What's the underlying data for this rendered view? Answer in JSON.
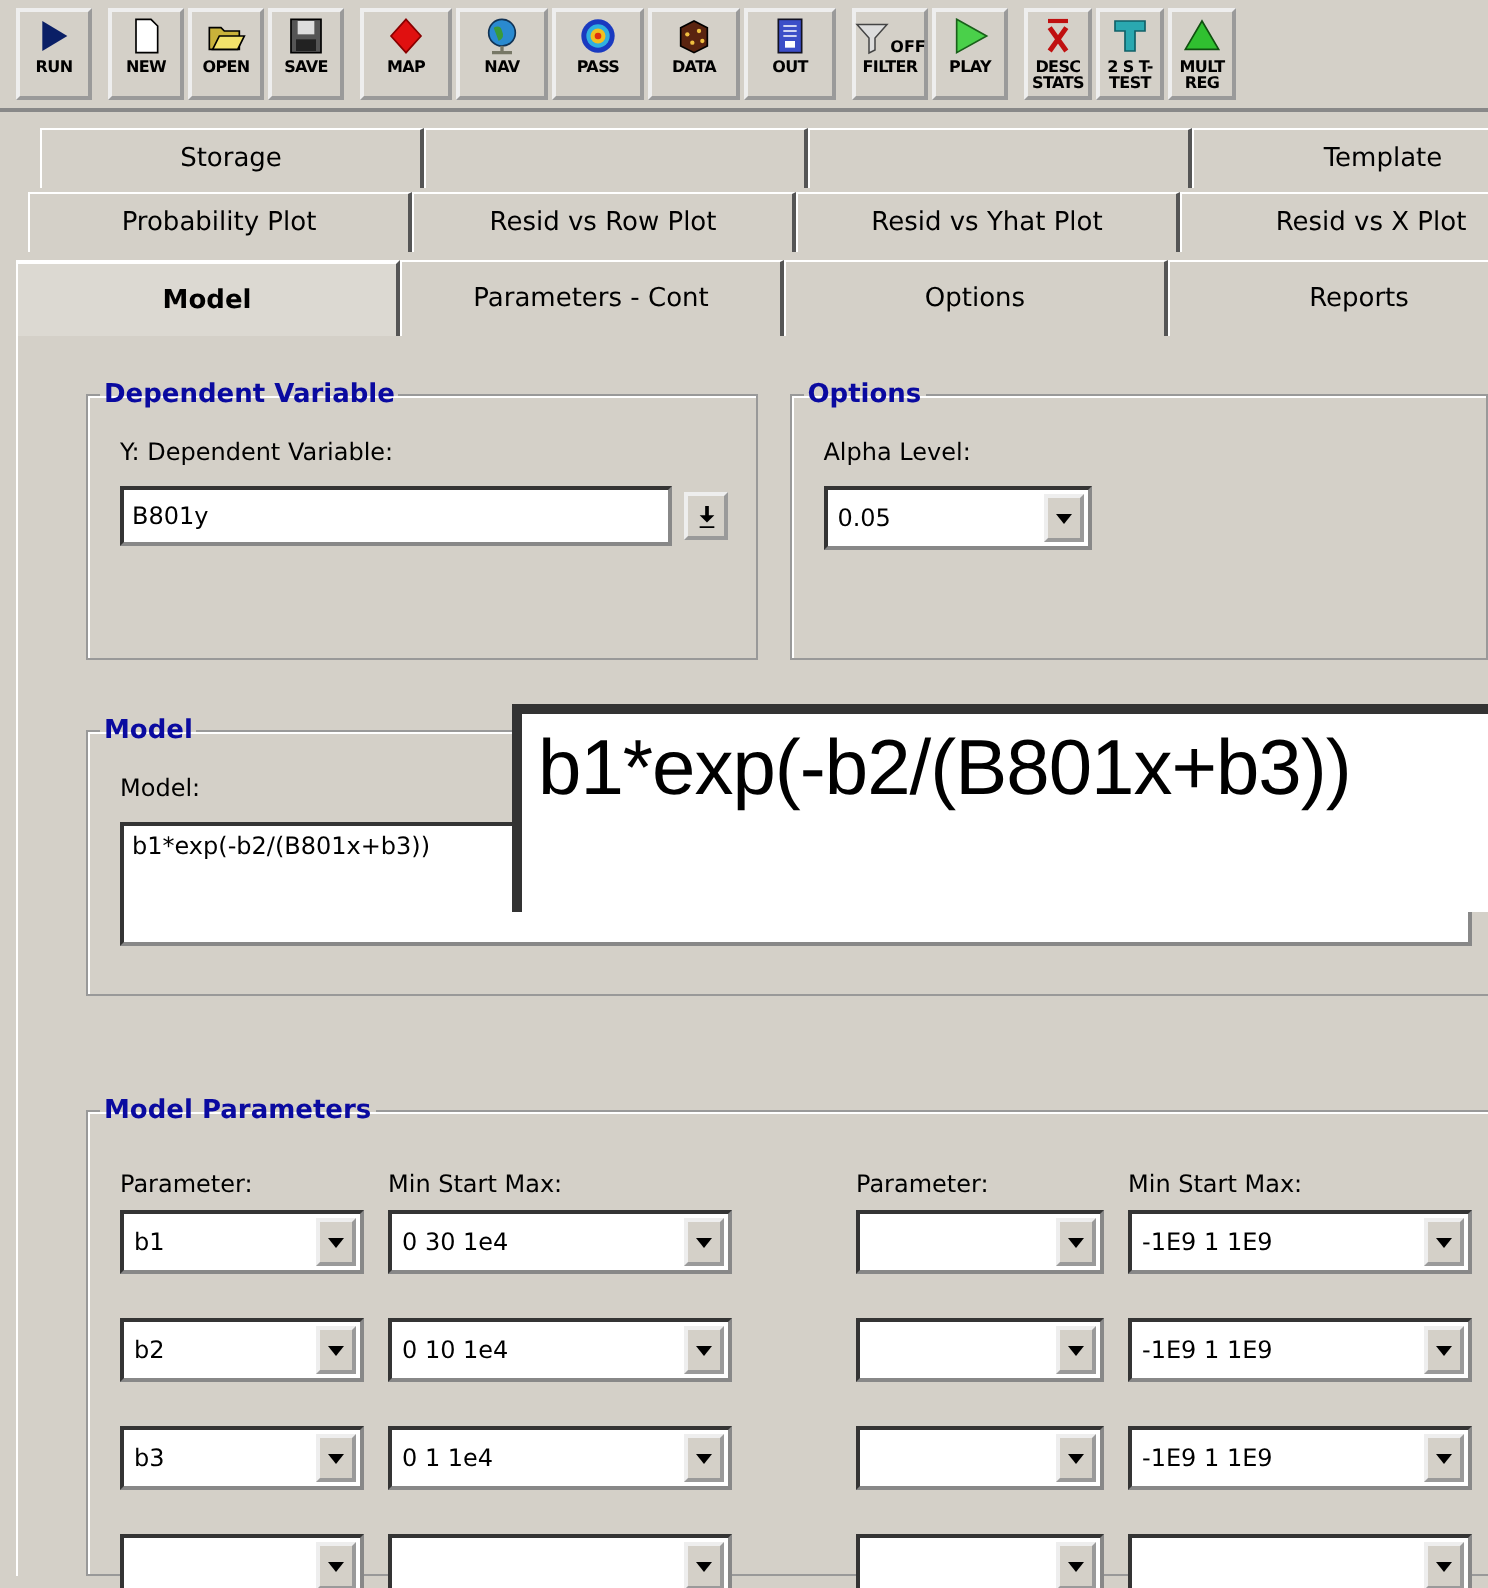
{
  "toolbar": {
    "groups": [
      [
        {
          "label": "RUN"
        }
      ],
      [
        {
          "label": "NEW"
        },
        {
          "label": "OPEN"
        },
        {
          "label": "SAVE"
        }
      ],
      [
        {
          "label": "MAP"
        },
        {
          "label": "NAV"
        },
        {
          "label": "PASS"
        },
        {
          "label": "DATA"
        },
        {
          "label": "OUT"
        }
      ],
      [
        {
          "label": "FILTER",
          "icon_text": "OFF"
        },
        {
          "label": "PLAY"
        }
      ],
      [
        {
          "label": "DESC STATS"
        },
        {
          "label": "2 S T-TEST"
        },
        {
          "label": "MULT REG"
        }
      ]
    ]
  },
  "tab_rows": [
    [
      {
        "label": "Storage",
        "selected": false
      },
      {
        "selected": false
      },
      {
        "selected": false
      },
      {
        "label": "Template",
        "selected": false
      }
    ],
    [
      {
        "label": "Probability Plot",
        "selected": false
      },
      {
        "label": "Resid vs Row Plot",
        "selected": false
      },
      {
        "label": "Resid vs Yhat Plot",
        "selected": false
      },
      {
        "label": "Resid vs X Plot",
        "selected": false
      }
    ],
    [
      {
        "label": "Model",
        "selected": true
      },
      {
        "label": "Parameters - Cont",
        "selected": false
      },
      {
        "label": "Options",
        "selected": false
      },
      {
        "label": "Reports",
        "selected": false
      }
    ]
  ],
  "dependent_variable": {
    "title": "Dependent Variable",
    "label": "Y: Dependent Variable:",
    "value": "B801y"
  },
  "options": {
    "title": "Options",
    "label": "Alpha Level:",
    "value": "0.05"
  },
  "model": {
    "title": "Model",
    "label": "Model:",
    "value": "b1*exp(-b2/(B801x+b3))"
  },
  "zoom_callout": {
    "text": "b1*exp(-b2/(B801x+b3))"
  },
  "model_parameters": {
    "title": "Model Parameters",
    "columns": [
      "Parameter:",
      "Min Start Max:",
      "Parameter:",
      "Min Start Max:"
    ],
    "rows": [
      {
        "cells": [
          "b1",
          "0 30 1e4",
          "",
          "-1E9 1 1E9"
        ]
      },
      {
        "cells": [
          "b2",
          "0 10 1e4",
          "",
          "-1E9 1 1E9"
        ]
      },
      {
        "cells": [
          "b3",
          "0 1 1e4",
          "",
          "-1E9 1 1E9"
        ]
      },
      {
        "cells": [
          "",
          "",
          "",
          ""
        ]
      }
    ]
  }
}
